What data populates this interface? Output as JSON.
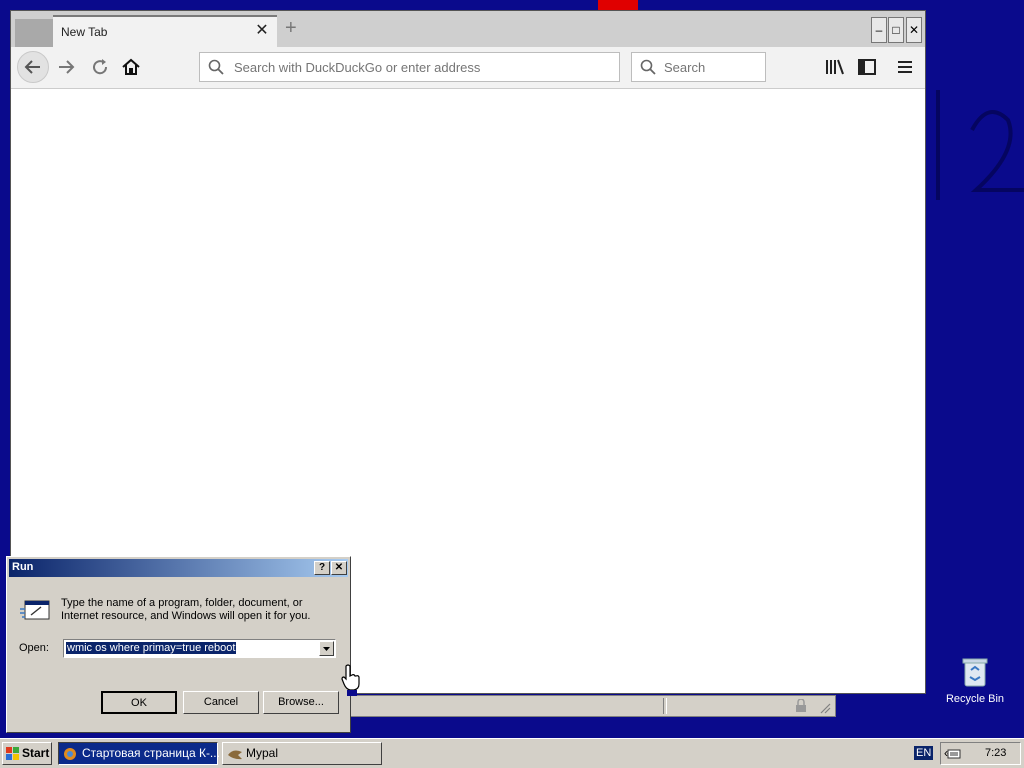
{
  "browser": {
    "tab_title": "New Tab",
    "tab_close": "✕",
    "new_tab": "+",
    "url_placeholder": "Search with DuckDuckGo or enter address",
    "search_placeholder": "Search",
    "window_minimize": "–",
    "window_maximize": "□",
    "window_close": "✕"
  },
  "taskbar": {
    "start_label": "Start",
    "tasks": [
      "Стартовая страница К-...",
      "Mypal"
    ],
    "language": "EN",
    "chevron": "«",
    "clock": "7:23"
  },
  "desktop": {
    "recycle_bin_label": "Recycle Bin"
  },
  "run_dialog": {
    "title": "Run",
    "help_button": "?",
    "close_button": "✕",
    "description": "Type the name of a program, folder, document, or Internet resource, and Windows will open it for you.",
    "open_label": "Open:",
    "open_value": "wmic os where primay=true reboot",
    "ok_label": "OK",
    "cancel_label": "Cancel",
    "browse_label": "Browse..."
  },
  "colors": {
    "desktop": "#0a0a8c",
    "title_bar_start": "#0a246a",
    "title_bar_end": "#a6caf0"
  }
}
